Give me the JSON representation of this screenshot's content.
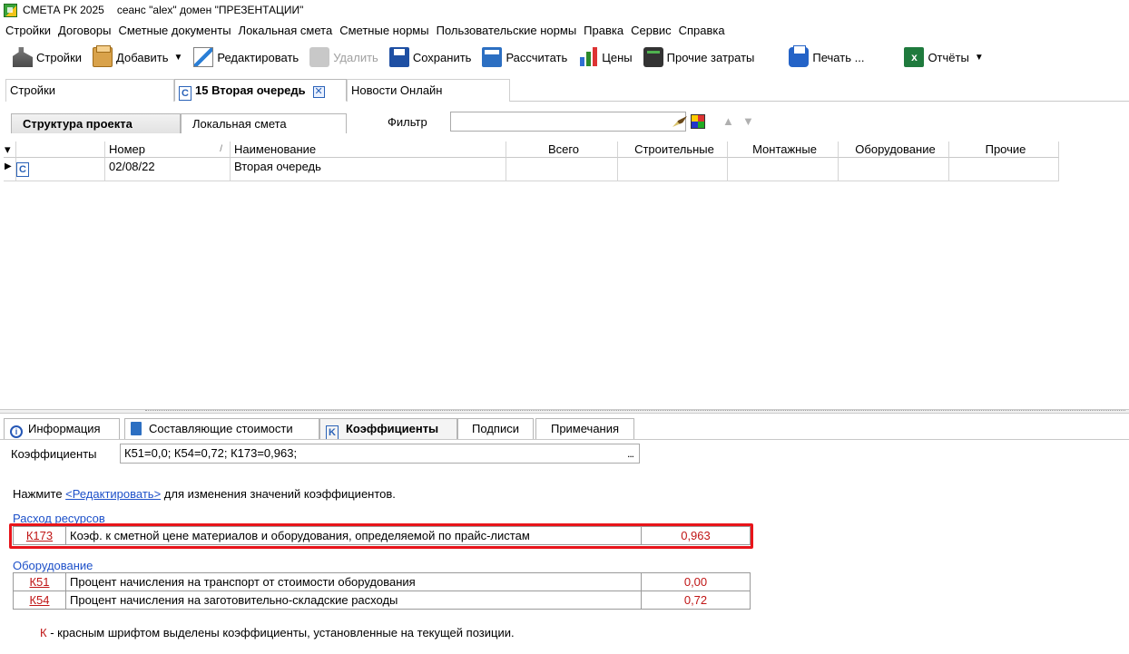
{
  "titlebar": {
    "app": "СМЕТА РК 2025",
    "session": "сеанс \"alex\" домен \"ПРЕЗЕНТАЦИИ\""
  },
  "menu": [
    "Стройки",
    "Договоры",
    "Сметные документы",
    "Локальная смета",
    "Сметные нормы",
    "Пользовательские нормы",
    "Правка",
    "Сервис",
    "Справка"
  ],
  "toolbar": {
    "stroiki": "Стройки",
    "add": "Добавить",
    "edit": "Редактировать",
    "delete": "Удалить",
    "save": "Сохранить",
    "calc": "Рассчитать",
    "prices": "Цены",
    "other": "Прочие затраты",
    "print": "Печать ...",
    "reports": "Отчёты",
    "excel_letter": "x"
  },
  "doctabs": {
    "stroiki": "Стройки",
    "active": "15 Вторая очередь",
    "news": "Новости Онлайн",
    "c_letter": "C",
    "close_glyph": "✕"
  },
  "subtabs": {
    "structure": "Структура проекта",
    "local": "Локальная смета"
  },
  "filter": {
    "label": "Фильтр",
    "value": ""
  },
  "grid": {
    "columns": {
      "nomer": "Номер",
      "name": "Наименование",
      "total": "Всего",
      "build": "Строительные",
      "mount": "Монтажные",
      "equip": "Оборудование",
      "other": "Прочие"
    },
    "sort_glyph": "/",
    "row": {
      "nomer": "02/08/22",
      "name": "Вторая очередь",
      "total": "",
      "build": "",
      "mount": "",
      "equip": "",
      "other": ""
    }
  },
  "bottom_tabs": {
    "info": "Информация",
    "cost": "Составляющие стоимости",
    "coef": "Коэффициенты",
    "sign": "Подписи",
    "notes": "Примечания",
    "i_letter": "i",
    "k_letter": "K"
  },
  "coefs": {
    "label": "Коэффициенты",
    "value": "К51=0,0; К54=0,72; К173=0,963;",
    "more": "...",
    "hint_before": "Нажмите ",
    "hint_link": "<Редактировать>",
    "hint_after": " для изменения значений коэффициентов."
  },
  "sections": [
    {
      "title": "Расход ресурсов",
      "rows": [
        {
          "code": "К173",
          "text": "Коэф. к сметной цене материалов и оборудования, определяемой по прайс-листам",
          "value": "0,963"
        }
      ]
    },
    {
      "title": "Оборудование",
      "rows": [
        {
          "code": "К51",
          "text": "Процент начисления на транспорт от стоимости оборудования",
          "value": "0,00"
        },
        {
          "code": "К54",
          "text": "Процент начисления на заготовительно-складские расходы",
          "value": "0,72"
        }
      ]
    }
  ],
  "legend": {
    "k": "К",
    "text": " - красным шрифтом выделены коэффициенты, установленные на текущей позиции."
  },
  "colors": {
    "accent_red": "#c01616",
    "link_blue": "#1d50c9",
    "highlight": "#e8141a"
  }
}
